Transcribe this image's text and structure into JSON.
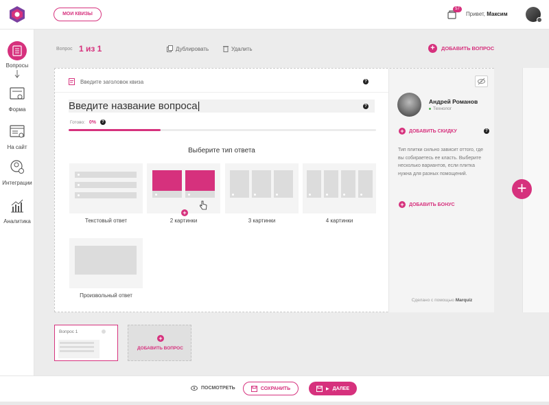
{
  "topbar": {
    "my_quizzes": "МОИ КВИЗЫ",
    "notifications_count": "57",
    "greeting_prefix": "Привет,",
    "user_name": "Максим"
  },
  "sidebar": {
    "items": [
      {
        "label": "Вопросы",
        "icon": "list-icon",
        "active": true
      },
      {
        "label": "Форма",
        "icon": "form-icon"
      },
      {
        "label": "На сайт",
        "icon": "website-icon"
      },
      {
        "label": "Интеграции",
        "icon": "integrations-icon"
      },
      {
        "label": "Аналитика",
        "icon": "analytics-icon"
      }
    ]
  },
  "question_bar": {
    "label": "Вопрос",
    "count": "1 из 1",
    "duplicate": "Дублировать",
    "delete": "Удалить",
    "add_question": "ДОБАВИТЬ ВОПРОС"
  },
  "editor": {
    "quiz_title_placeholder": "Введите заголовок квиза",
    "question_placeholder": "Введите название вопроса",
    "ready_label": "Готово:",
    "ready_percent": "0%",
    "progress_fraction": 0.3,
    "choose_type": "Выберите тип ответа",
    "answer_types": [
      {
        "label": "Текстовый ответ"
      },
      {
        "label": "2 картинки"
      },
      {
        "label": "3 картинки"
      },
      {
        "label": "4 картинки"
      },
      {
        "label": "Произвольный ответ"
      }
    ]
  },
  "panel": {
    "author_name": "Андрей Романов",
    "author_role": "Технолог",
    "add_discount": "ДОБАВИТЬ СКИДКУ",
    "hint": "Тип плитки сильно зависит оттого, где вы собираетесь ее класть. Выберите несколько вариантов, если плитка нужна для разных помощений.",
    "add_bonus": "ДОБАВИТЬ БОНУС",
    "made_with": "Сделано с помощью",
    "brand": "Marquiz"
  },
  "thumbnails": {
    "question_1": "Вопрос 1",
    "add_question": "ДОБАВИТЬ ВОПРОС"
  },
  "bottom": {
    "view": "ПОСМОТРЕТЬ",
    "save": "СОХРАНИТЬ",
    "next": "ДАЛЕЕ"
  },
  "colors": {
    "accent": "#d6317d",
    "background": "#ececec"
  }
}
